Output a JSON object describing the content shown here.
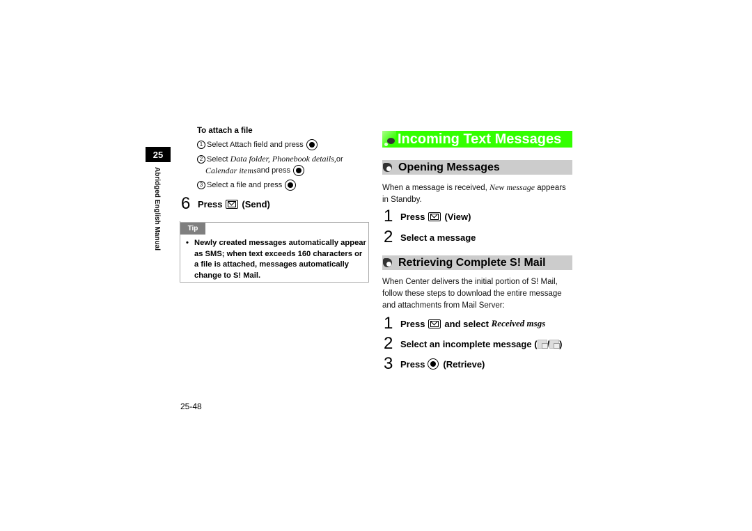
{
  "sidebar": {
    "chapter_number": "25",
    "chapter_label": "Abridged English Manual"
  },
  "left": {
    "attach": {
      "heading": "To attach a file",
      "steps": [
        {
          "num": "1",
          "text": "Select Attach field and press",
          "key": "center-key"
        },
        {
          "num": "2",
          "text_pre": "Select ",
          "italic1": "Data folder, Phonebook details,",
          "text_mid": " or",
          "italic2": "Calendar items",
          "text_post": " and press",
          "key": "center-key"
        },
        {
          "num": "3",
          "text": "Select a file and press",
          "key": "center-key"
        }
      ]
    },
    "step6": {
      "num": "6",
      "press": "Press",
      "key": "mail-key",
      "label": "(Send)"
    },
    "tip": {
      "label": "Tip",
      "bullet": "•",
      "text": "Newly created messages automatically appear as SMS; when text exceeds 160 characters or a file is attached, messages automatically change to S! Mail."
    },
    "page_number": "25-48"
  },
  "right": {
    "title": "Incoming Text Messages",
    "opening": {
      "heading": "Opening Messages",
      "intro_pre": "When a message is received, ",
      "intro_italic": "New message",
      "intro_post": " appears in Standby.",
      "steps": [
        {
          "num": "1",
          "press": "Press",
          "key": "mail-key",
          "label": "(View)"
        },
        {
          "num": "2",
          "label": "Select a message"
        }
      ]
    },
    "retrieving": {
      "heading": "Retrieving Complete S! Mail",
      "intro": "When Center delivers the initial portion of S! Mail, follow these steps to download the entire message and attachments from Mail Server:",
      "steps": [
        {
          "num": "1",
          "press": "Press",
          "key": "mail-key",
          "label": "and select ",
          "italic": "Received msgs"
        },
        {
          "num": "2",
          "label": "Select an incomplete message (",
          "icons": [
            "incomplete-message-icon",
            "incomplete-message-attachment-icon"
          ],
          "sep": "/",
          "close": ")"
        },
        {
          "num": "3",
          "press": "Press",
          "key": "center-key",
          "label": "(Retrieve)"
        }
      ]
    }
  }
}
